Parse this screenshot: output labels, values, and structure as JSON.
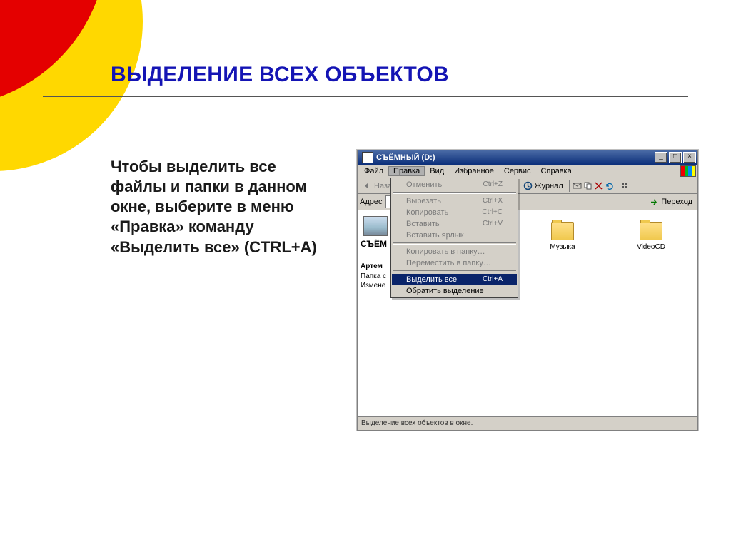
{
  "slide": {
    "title": "ВЫДЕЛЕНИЕ ВСЕХ ОБЪЕКТОВ",
    "body": "Чтобы выделить все файлы и папки в данном окне, выберите в меню «Правка» команду «Выделить все» (CTRL+A)"
  },
  "window": {
    "title": "СЪЁМНЫЙ (D:)",
    "minimize": "_",
    "maximize": "□",
    "close": "×",
    "menu": {
      "file": "Файл",
      "edit": "Правка",
      "view": "Вид",
      "favorites": "Избранное",
      "tools": "Сервис",
      "help": "Справка"
    },
    "toolbar": {
      "back": "Назад",
      "journal": "Журнал"
    },
    "addressbar": {
      "label": "Адрес",
      "go": "Переход"
    },
    "menu_edit": {
      "undo": {
        "label": "Отменить",
        "shortcut": "Ctrl+Z"
      },
      "cut": {
        "label": "Вырезать",
        "shortcut": "Ctrl+X"
      },
      "copy": {
        "label": "Копировать",
        "shortcut": "Ctrl+C"
      },
      "paste": {
        "label": "Вставить",
        "shortcut": "Ctrl+V"
      },
      "paste_shortcut": {
        "label": "Вставить ярлык",
        "shortcut": ""
      },
      "copy_to_folder": {
        "label": "Копировать в папку…",
        "shortcut": ""
      },
      "move_to_folder": {
        "label": "Переместить в папку…",
        "shortcut": ""
      },
      "select_all": {
        "label": "Выделить все",
        "shortcut": "Ctrl+A"
      },
      "invert_selection": {
        "label": "Обратить выделение",
        "shortcut": ""
      }
    },
    "sidebar": {
      "drive_label": "СЪЁМ",
      "selection_name": "Артем",
      "line2": "Папка с",
      "line3": "Измене"
    },
    "folders": {
      "music": "Музыка",
      "videocd": "VideoCD"
    },
    "status": "Выделение всех объектов в окне."
  }
}
